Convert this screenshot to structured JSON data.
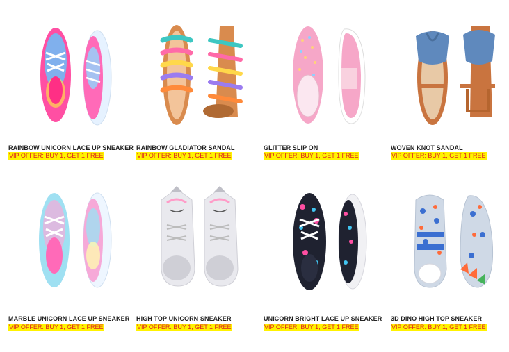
{
  "products": [
    {
      "name": "RAINBOW UNICORN LACE UP SNEAKER",
      "offer": "VIP OFFER: BUY 1, GET 1 FREE",
      "image_icon": "rainbow-unicorn-sneaker",
      "colors": [
        "#ff4fa3",
        "#60c8ff",
        "#ffd84a"
      ]
    },
    {
      "name": "RAINBOW GLADIATOR SANDAL",
      "offer": "VIP OFFER: BUY 1, GET 1 FREE",
      "image_icon": "rainbow-gladiator-sandal",
      "colors": [
        "#d98b4e",
        "#3ec7c2",
        "#ff6aa8"
      ]
    },
    {
      "name": "GLITTER SLIP ON",
      "offer": "VIP OFFER: BUY 1, GET 1 FREE",
      "image_icon": "glitter-slip-on",
      "colors": [
        "#f6a7c8",
        "#f9d1df",
        "#ffd27a"
      ]
    },
    {
      "name": "WOVEN KNOT SANDAL",
      "offer": "VIP OFFER: BUY 1, GET 1 FREE",
      "image_icon": "woven-knot-sandal",
      "colors": [
        "#5f89bd",
        "#c9743f",
        "#e8c9a6"
      ]
    },
    {
      "name": "MARBLE UNICORN LACE UP SNEAKER",
      "offer": "VIP OFFER: BUY 1, GET 1 FREE",
      "image_icon": "marble-unicorn-sneaker",
      "colors": [
        "#9fe0f2",
        "#f6a9d8",
        "#fff7b0"
      ]
    },
    {
      "name": "HIGH TOP UNICORN SNEAKER",
      "offer": "VIP OFFER: BUY 1, GET 1 FREE",
      "image_icon": "high-top-unicorn-sneaker",
      "colors": [
        "#e9e9ee",
        "#ff9cc8",
        "#bfbfc7"
      ]
    },
    {
      "name": "UNICORN BRIGHT LACE UP SNEAKER",
      "offer": "VIP OFFER: BUY 1, GET 1 FREE",
      "image_icon": "unicorn-bright-sneaker",
      "colors": [
        "#1f2230",
        "#ff4fa3",
        "#41c4f0"
      ]
    },
    {
      "name": "3D DINO HIGH TOP SNEAKER",
      "offer": "VIP OFFER: BUY 1, GET 1 FREE",
      "image_icon": "dino-high-top-sneaker",
      "colors": [
        "#cfd9e6",
        "#3b6fd1",
        "#ff6b3a"
      ]
    }
  ]
}
